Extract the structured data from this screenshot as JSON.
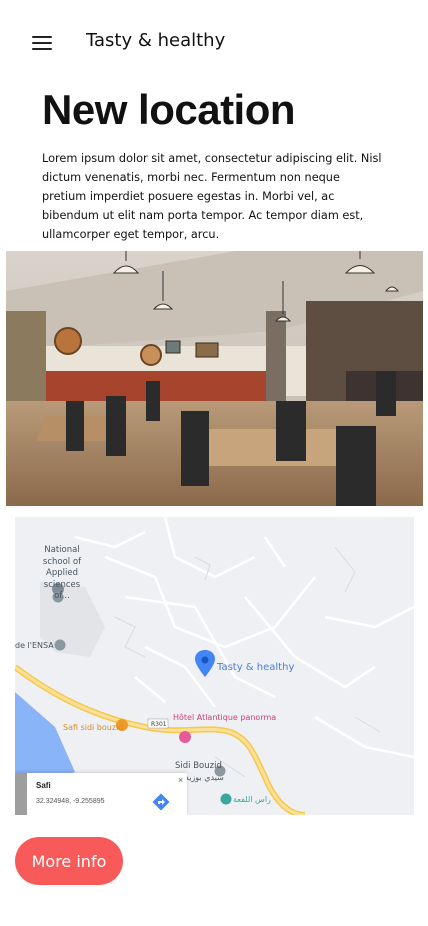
{
  "app": {
    "title": "Tasty & healthy"
  },
  "page": {
    "title": "New location",
    "paragraph": "Lorem ipsum dolor sit amet, consectetur adipiscing elit. Nisl dictum venenatis, morbi nec. Fermentum non neque pretium imperdiet posuere egestas in. Morbi vel, ac bibendum ut elit nam porta tempor. Ac tempor diam est, ullamcorper eget tempor, arcu."
  },
  "hero_image": {
    "icon": "restaurant-interior-photo"
  },
  "map": {
    "labels": {
      "school": [
        "National",
        "school of",
        "Applied",
        "sciences of..."
      ],
      "ensa": "de l'ENSA",
      "marker": "Tasty & healthy",
      "safi_sidi": "Safi sidi bouzid",
      "road": "R301",
      "hotel": "Hôtel Atlantique panorma",
      "sidi_bouzid": "Sidi Bouzid",
      "sidi_bouzid_ar": "سيدي بوزيد",
      "ras_laflaa": "راس اللفعة"
    },
    "card": {
      "place": "Safi",
      "coords": "32.324948, -9.255895",
      "close": "×"
    }
  },
  "button": {
    "more_info": "More info"
  },
  "colors": {
    "accent": "#f85a5a",
    "marker": "#4285f4",
    "road": "#f6c84c",
    "water": "#8ab4f8"
  }
}
